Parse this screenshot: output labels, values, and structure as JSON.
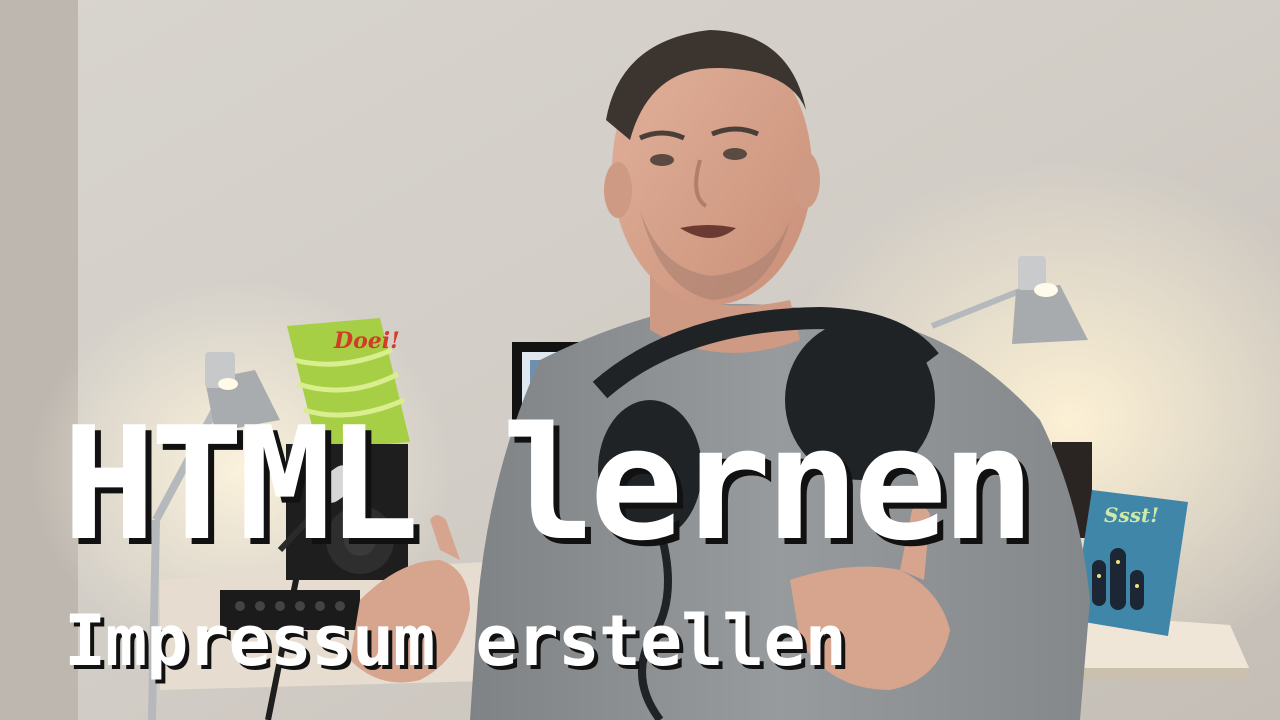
{
  "overlay": {
    "title": "HTML lernen",
    "subtitle": "Impressum erstellen"
  },
  "props": {
    "left_book_title": "Doei!",
    "right_book_title": "Ssst!"
  },
  "colors": {
    "wall": "#d4cfc8",
    "shirt": "#8e9294",
    "skin": "#d9a58f",
    "green_book": "#a8cf45",
    "blue_book": "#3f86a8",
    "desk": "#e8e0d4",
    "lamp": "#b9bcbf",
    "text": "#ffffff",
    "text_shadow": "#111111"
  }
}
